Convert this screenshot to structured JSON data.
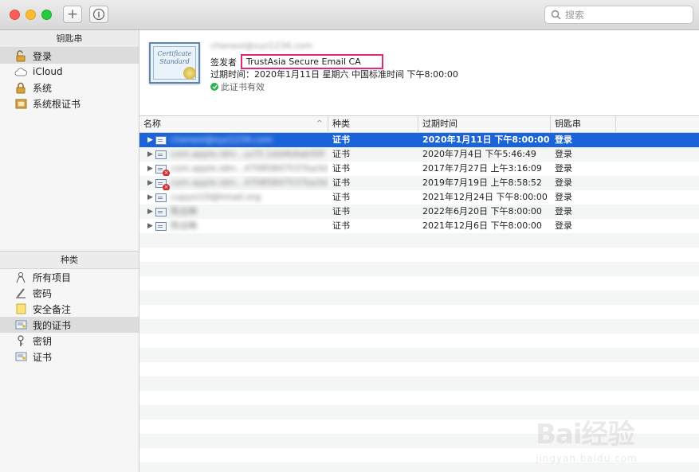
{
  "toolbar": {
    "add_symbol": "+",
    "info_symbol": "i",
    "search_placeholder": "搜索"
  },
  "sidebar": {
    "keychains_header": "钥匙串",
    "keychains": [
      {
        "label": "登录",
        "icon": "lock-open-icon",
        "selected": true
      },
      {
        "label": "iCloud",
        "icon": "cloud-icon",
        "selected": false
      },
      {
        "label": "系统",
        "icon": "lock-icon",
        "selected": false
      },
      {
        "label": "系统根证书",
        "icon": "cabinet-icon",
        "selected": false
      }
    ],
    "categories_header": "种类",
    "categories": [
      {
        "label": "所有项目",
        "icon": "people-icon",
        "selected": false
      },
      {
        "label": "密码",
        "icon": "pen-icon",
        "selected": false
      },
      {
        "label": "安全备注",
        "icon": "note-icon",
        "selected": false
      },
      {
        "label": "我的证书",
        "icon": "my-cert-icon",
        "selected": true
      },
      {
        "label": "密钥",
        "icon": "key-icon",
        "selected": false
      },
      {
        "label": "证书",
        "icon": "cert-icon",
        "selected": false
      }
    ]
  },
  "detail": {
    "cert_image_text": "Certificate Standard",
    "name": "cheneol@xyz1234.com",
    "issuer_label": "签发者",
    "issuer": "TrustAsia Secure Email CA",
    "expiry": "过期时间：2020年1月11日 星期六 中国标准时间 下午8:00:00",
    "valid_text": "此证书有效"
  },
  "table": {
    "columns": [
      "名称",
      "种类",
      "过期时间",
      "钥匙串"
    ],
    "sort_indicator": "^",
    "rows": [
      {
        "name": "cheneol@xyz1234.com",
        "kind": "证书",
        "expiry": "2020年1月11日 下午8:00:00",
        "keychain": "登录",
        "invalid": false,
        "selected": true
      },
      {
        "name": "com.apple.idm...ucf3.1dd4b6ab50f",
        "kind": "证书",
        "expiry": "2020年7月4日 下午5:46:49",
        "keychain": "登录",
        "invalid": false,
        "selected": false
      },
      {
        "name": "com.apple.idm...47085847537ba3d",
        "kind": "证书",
        "expiry": "2017年7月27日 上午3:16:09",
        "keychain": "登录",
        "invalid": true,
        "selected": false
      },
      {
        "name": "com.apple.idm...47085847537ba3d",
        "kind": "证书",
        "expiry": "2019年7月19日 上午8:58:52",
        "keychain": "登录",
        "invalid": true,
        "selected": false
      },
      {
        "name": "cupyxi10@hmail.org",
        "kind": "证书",
        "expiry": "2021年12月24日 下午8:00:00",
        "keychain": "登录",
        "invalid": false,
        "selected": false
      },
      {
        "name": "陈远琳",
        "kind": "证书",
        "expiry": "2022年6月20日 下午8:00:00",
        "keychain": "登录",
        "invalid": false,
        "selected": false
      },
      {
        "name": "陈远琳",
        "kind": "证书",
        "expiry": "2021年12月6日 下午8:00:00",
        "keychain": "登录",
        "invalid": false,
        "selected": false
      }
    ]
  },
  "watermark": {
    "brand": "Bai经验",
    "site": "jingyan.baidu.com"
  }
}
